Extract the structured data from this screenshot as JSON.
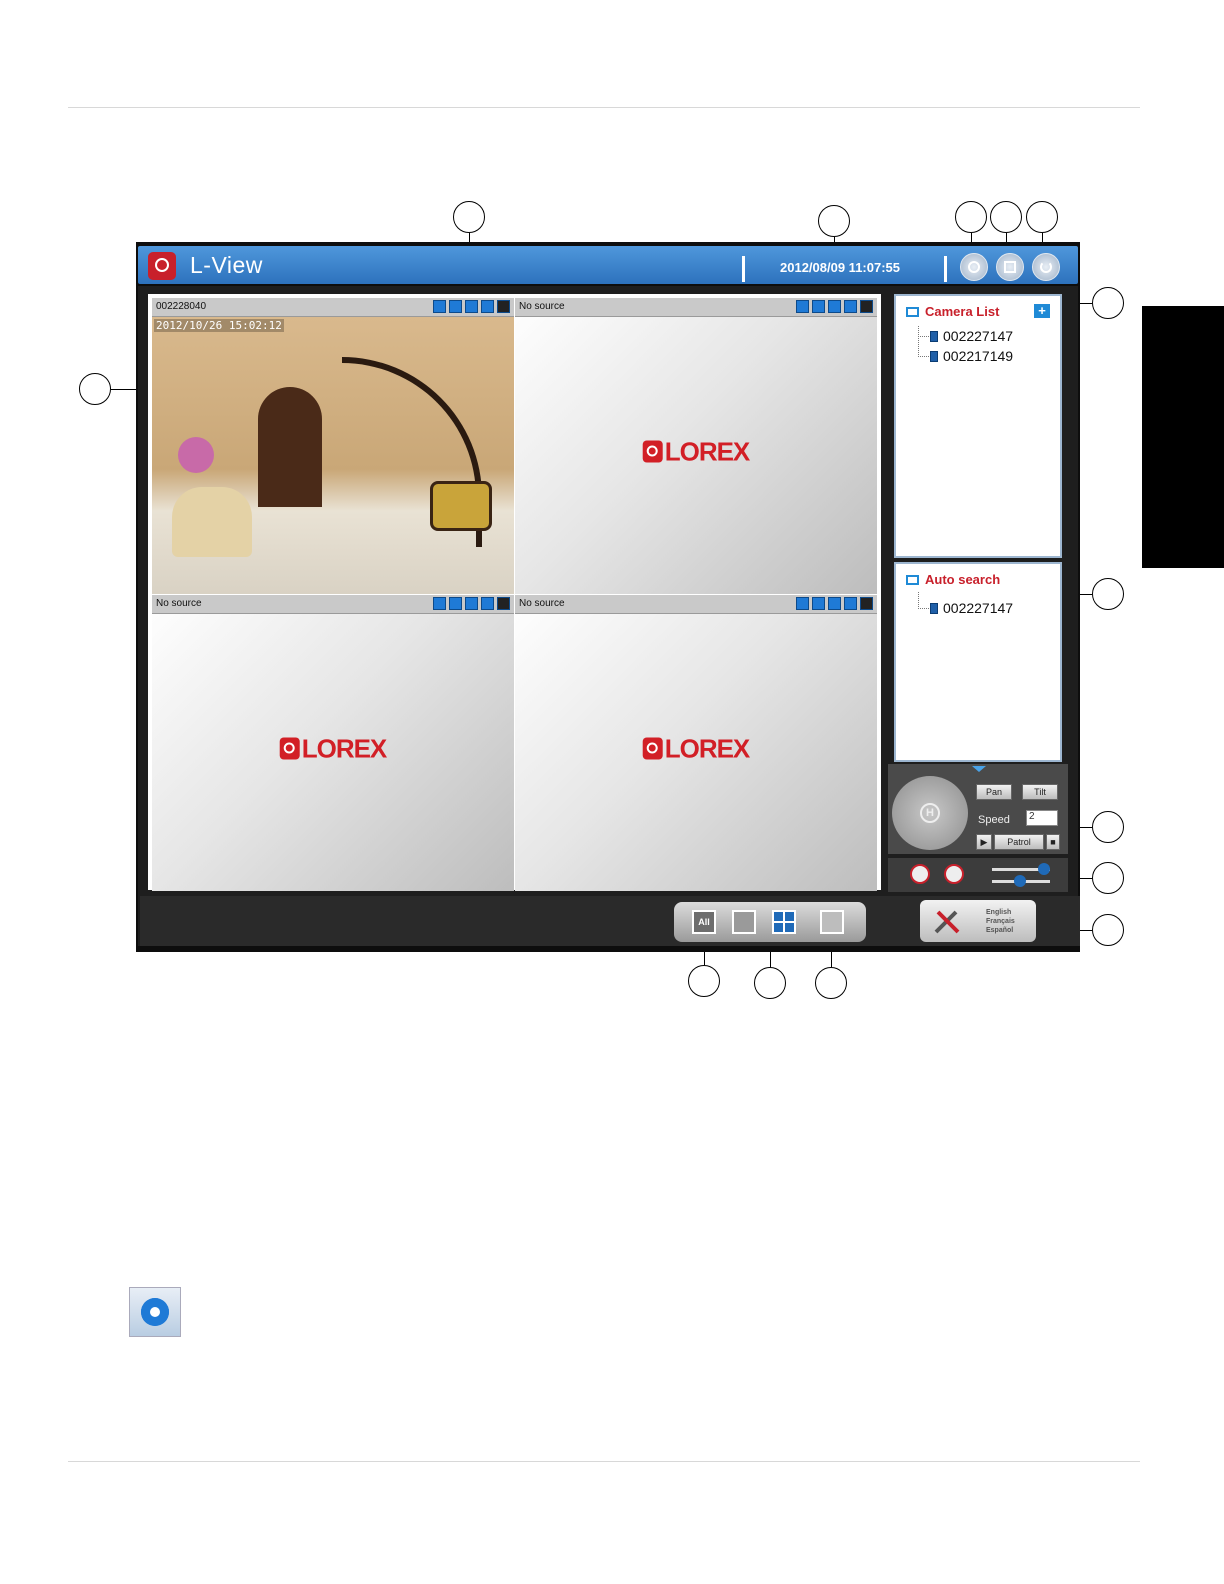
{
  "app": {
    "title": "L-View",
    "datetime": "2012/08/09 11:07:55"
  },
  "header_buttons": [
    {
      "icon": "record-icon"
    },
    {
      "icon": "snapshot-icon"
    },
    {
      "icon": "power-icon"
    }
  ],
  "cells": [
    {
      "label": "002228040",
      "timestamp": "2012/10/26 15:02:12",
      "has_feed": true
    },
    {
      "label": "No source",
      "has_feed": false
    },
    {
      "label": "No source",
      "has_feed": false
    },
    {
      "label": "No source",
      "has_feed": false
    }
  ],
  "logo_text": "LOREX",
  "camera_list": {
    "title": "Camera List",
    "items": [
      "002227147",
      "002217149"
    ]
  },
  "auto_search": {
    "title": "Auto search",
    "items": [
      "002227147"
    ]
  },
  "ptz": {
    "pan_label": "Pan",
    "tilt_label": "Tilt",
    "speed_label": "Speed",
    "speed_value": "2",
    "patrol_label": "Patrol",
    "home_label": "H"
  },
  "view_modes": {
    "all_label": "All"
  },
  "languages": [
    "English",
    "Français",
    "Español"
  ],
  "colors": {
    "header_blue": "#2d72bd",
    "accent_red": "#c8202b",
    "icon_blue": "#1f7ad6"
  }
}
